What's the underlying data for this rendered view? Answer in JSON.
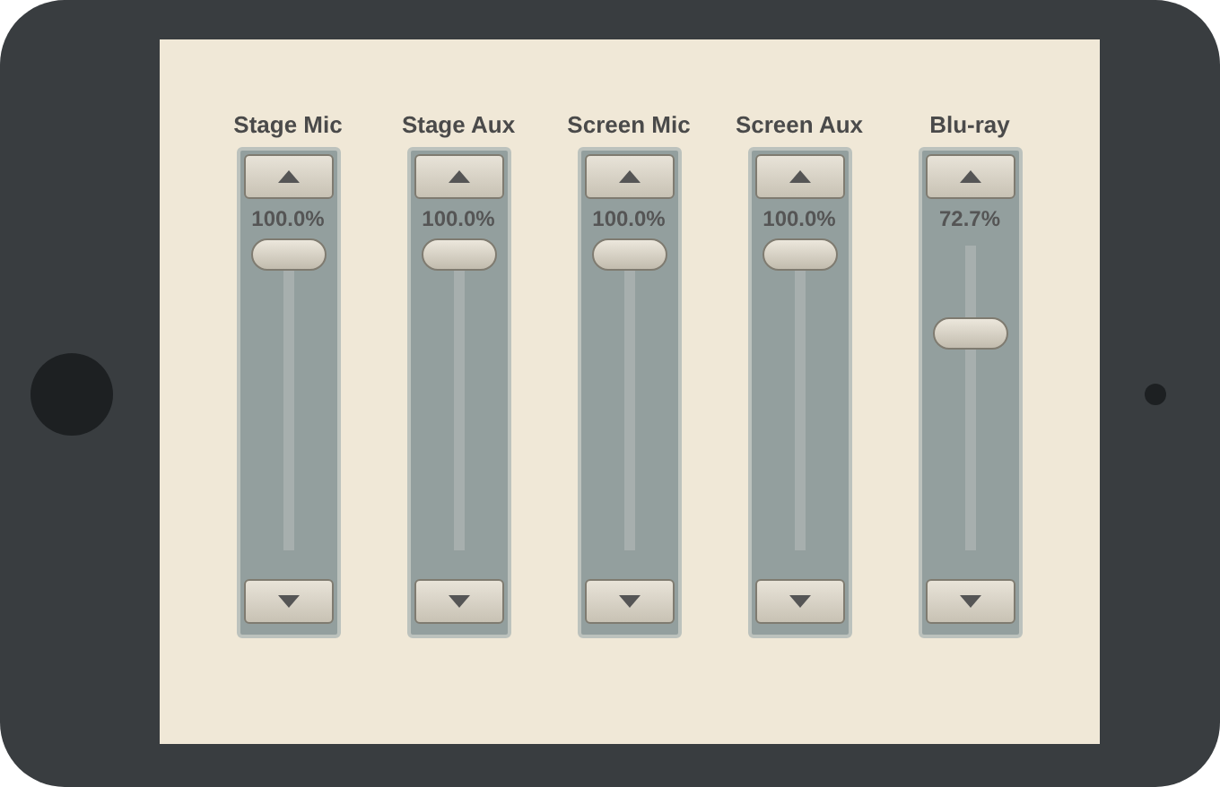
{
  "channels": [
    {
      "name": "Stage Mic",
      "reading": "100.0%",
      "level": 1.0
    },
    {
      "name": "Stage Aux",
      "reading": "100.0%",
      "level": 1.0
    },
    {
      "name": "Screen Mic",
      "reading": "100.0%",
      "level": 1.0
    },
    {
      "name": "Screen Aux",
      "reading": "100.0%",
      "level": 1.0
    },
    {
      "name": "Blu-ray",
      "reading": "72.7%",
      "level": 0.727
    }
  ]
}
